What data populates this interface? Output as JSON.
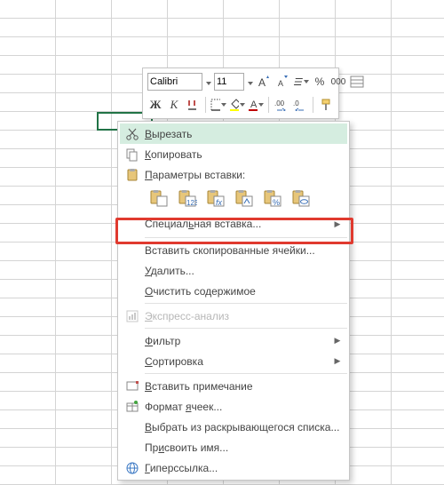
{
  "toolbar": {
    "font_name": "Calibri",
    "font_size": "11",
    "percent_label": "%",
    "thousands_label": "000",
    "bold_label": "Ж",
    "italic_label": "К",
    "comma_label": ","
  },
  "menu": {
    "cut": "Вырезать",
    "copy": "Копировать",
    "paste_options": "Параметры вставки:",
    "paste_special": "Специальная вставка...",
    "insert_copied": "Вставить скопированные ячейки...",
    "delete": "Удалить...",
    "clear": "Очистить содержимое",
    "quick_analysis": "Экспресс-анализ",
    "filter": "Фильтр",
    "sort": "Сортировка",
    "insert_comment": "Вставить примечание",
    "format_cells": "Формат ячеек...",
    "dropdown_list": "Выбрать из раскрывающегося списка...",
    "define_name": "Присвоить имя...",
    "hyperlink": "Гиперссылка..."
  },
  "paste_icons": [
    "paste-normal",
    "paste-values",
    "paste-formulas",
    "paste-transpose",
    "paste-formatting",
    "paste-link"
  ]
}
